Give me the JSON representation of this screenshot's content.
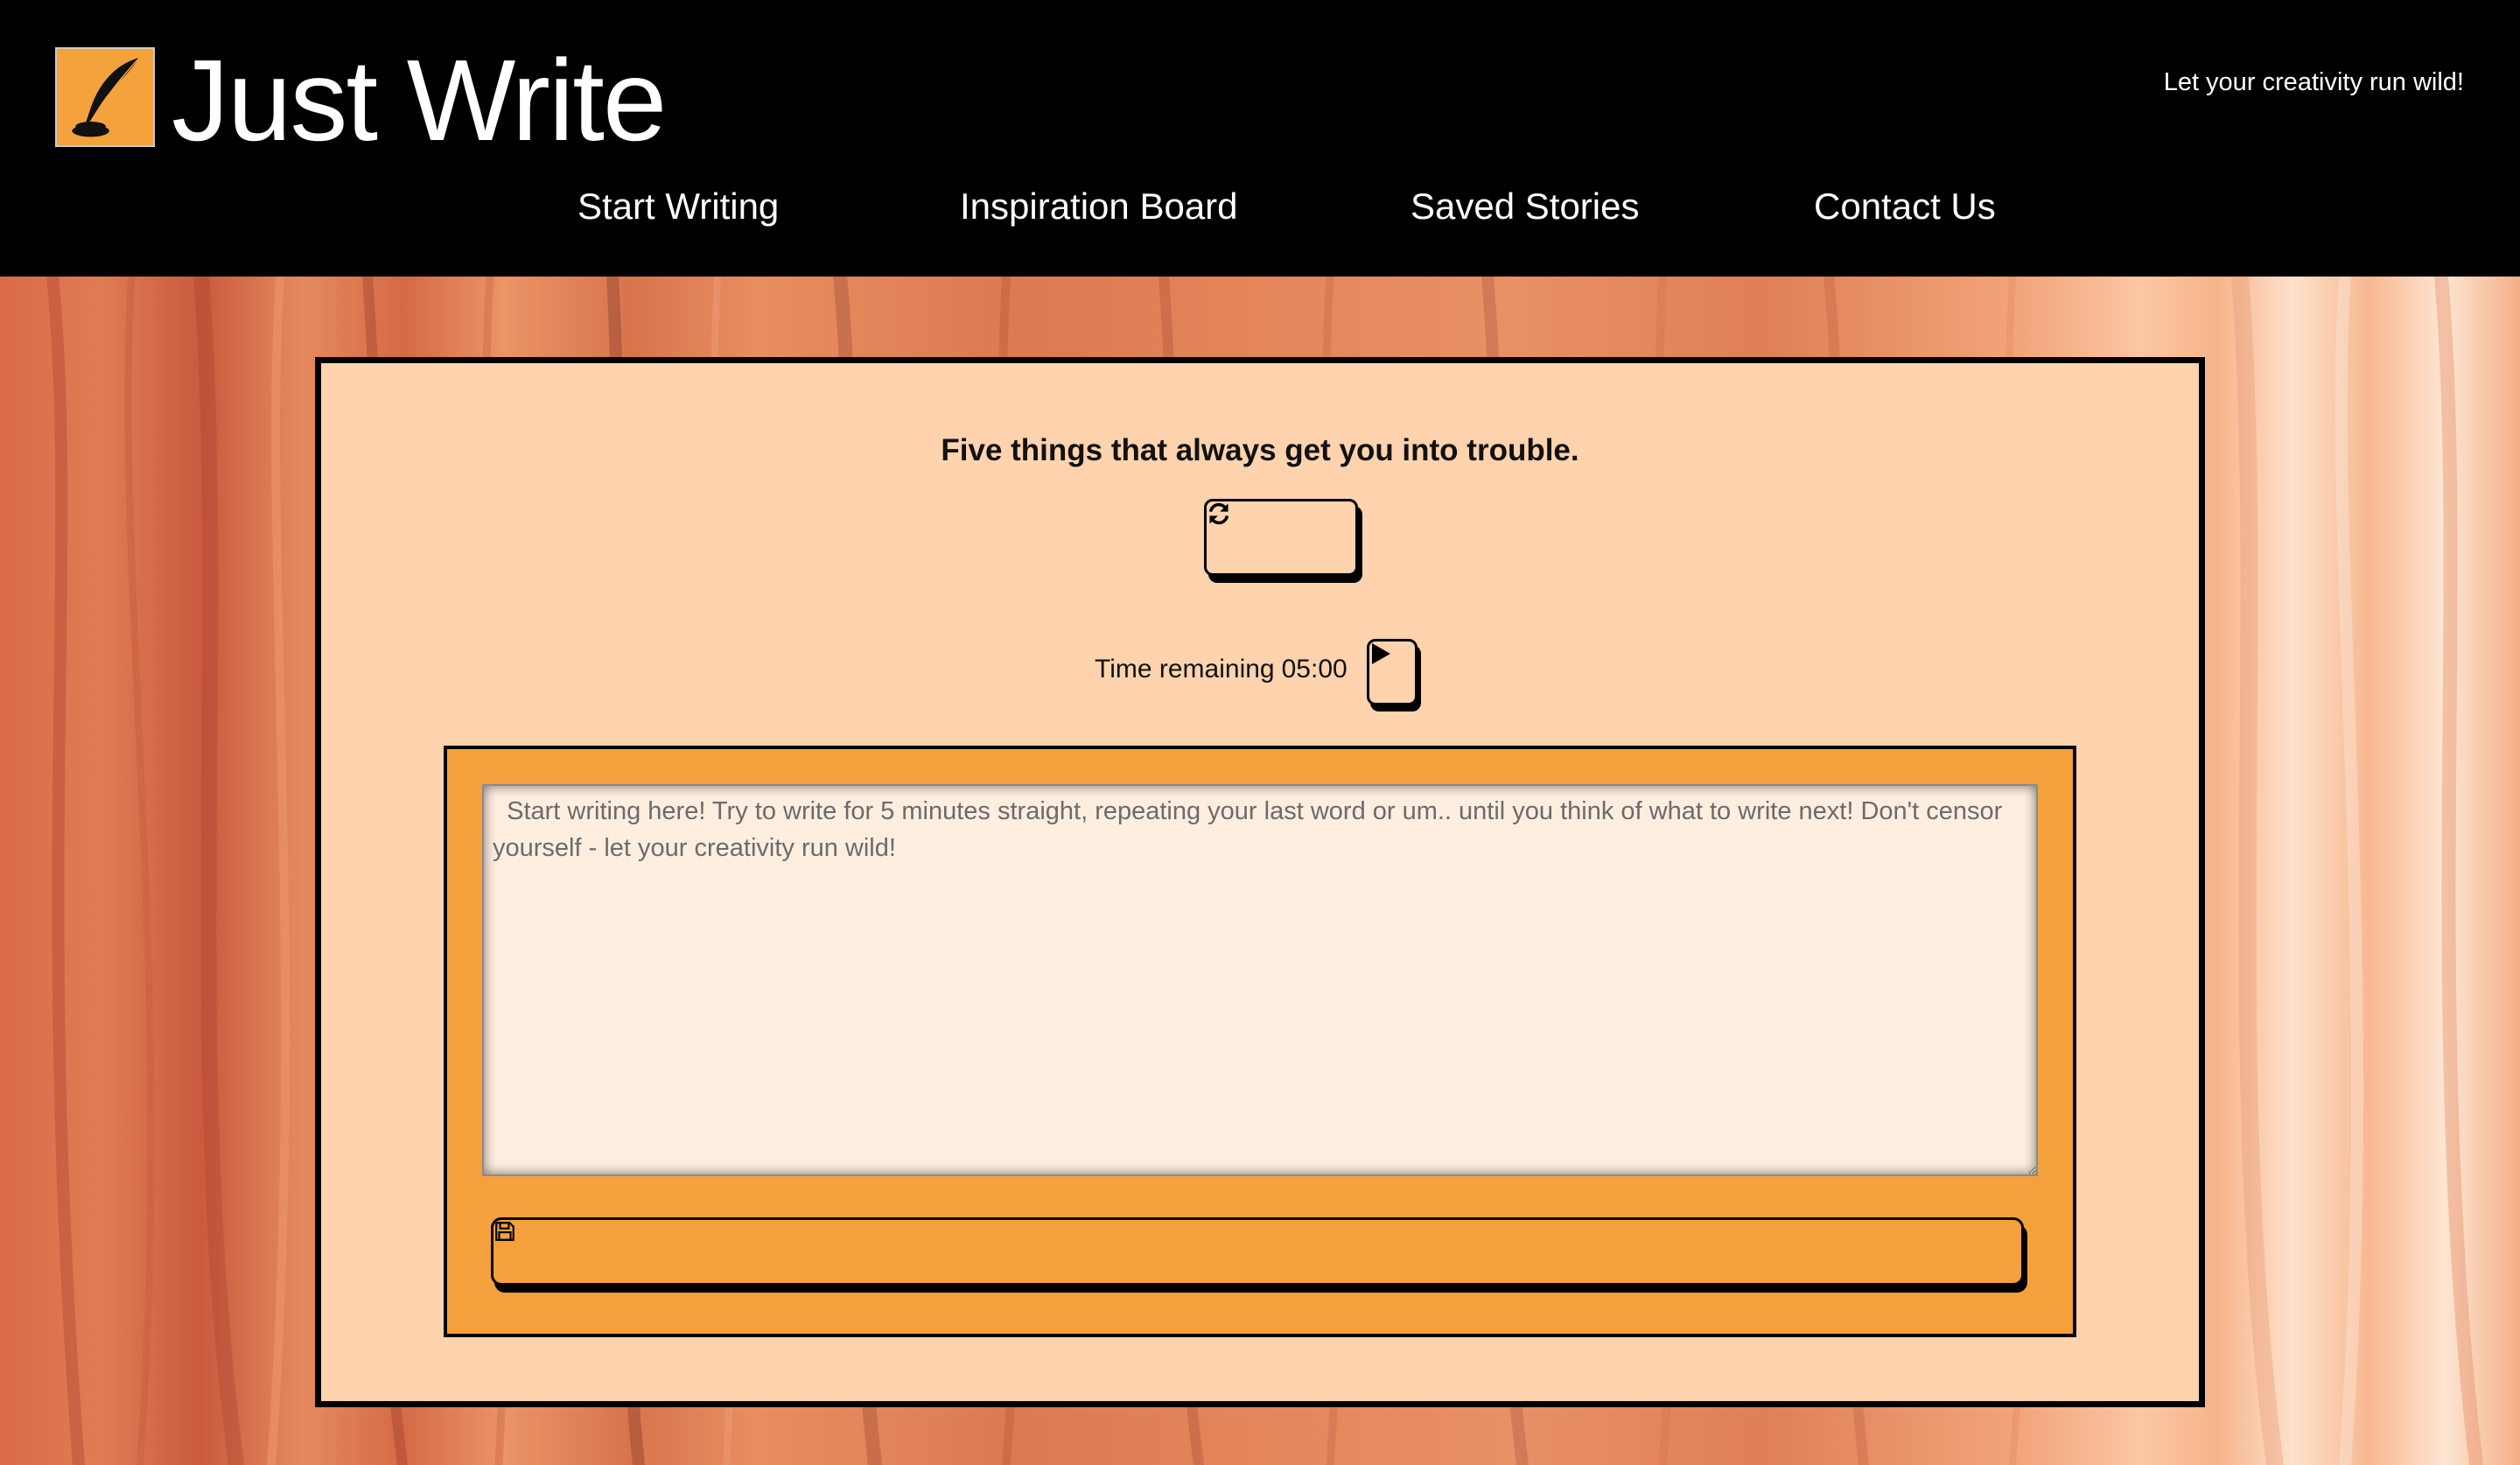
{
  "header": {
    "title": "Just Write",
    "tagline": "Let your creativity run wild!",
    "logo_icon": "quill-inkwell-icon"
  },
  "nav": {
    "items": [
      {
        "label": "Start Writing"
      },
      {
        "label": "Inspiration Board"
      },
      {
        "label": "Saved Stories"
      },
      {
        "label": "Contact Us"
      }
    ]
  },
  "prompt": {
    "text": "Five things that always get you into trouble.",
    "refresh_icon": "refresh-icon"
  },
  "timer": {
    "label": "Time remaining",
    "value": "05:00",
    "play_icon": "play-icon"
  },
  "editor": {
    "placeholder": "  Start writing here! Try to write for 5 minutes straight, repeating your last word or um.. until you think of what to write next! Don't censor yourself - let your creativity run wild!",
    "value": ""
  },
  "save": {
    "icon": "save-icon"
  },
  "colors": {
    "header_bg": "#000000",
    "panel_bg": "#fed3ae",
    "accent_orange": "#f4a13d",
    "textarea_bg": "#feeee0"
  }
}
